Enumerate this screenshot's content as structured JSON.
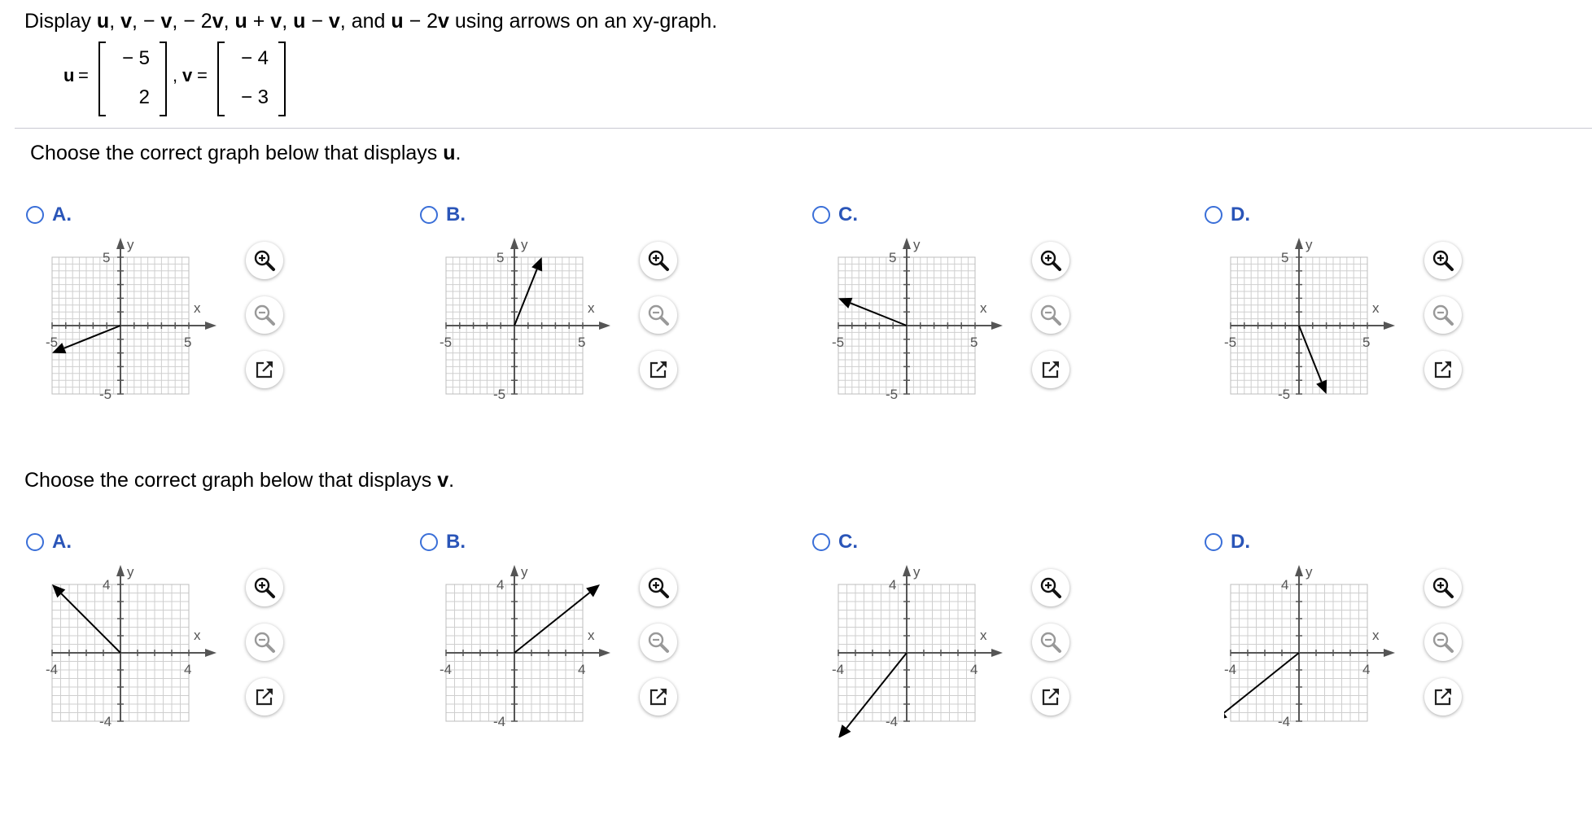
{
  "problem": {
    "prompt_parts": [
      "Display ",
      "u",
      ", ",
      "v",
      ",  − ",
      "v",
      ",  − 2",
      "v",
      ", ",
      "u",
      " + ",
      "v",
      ", ",
      "u",
      " − ",
      "v",
      ", and ",
      "u",
      " − 2",
      "v",
      " using arrows on an xy-graph."
    ],
    "u_label": "u",
    "v_label": "v",
    "equals": "=",
    "comma": ",",
    "u_entries": [
      "− 5",
      "2"
    ],
    "v_entries": [
      "− 4",
      "− 3"
    ]
  },
  "questions": [
    {
      "text_before": "Choose the correct graph below that displays ",
      "text_bold": "u",
      "text_after": ".",
      "range": 5,
      "tick_labels": {
        "x_neg": "-5",
        "x_pos": "5",
        "y_pos": "5",
        "y_neg": "-5"
      },
      "options": [
        {
          "letter": "A.",
          "vector": [
            -5,
            -2
          ]
        },
        {
          "letter": "B.",
          "vector": [
            2,
            5
          ]
        },
        {
          "letter": "C.",
          "vector": [
            -5,
            2
          ]
        },
        {
          "letter": "D.",
          "vector": [
            2,
            -5
          ]
        }
      ]
    },
    {
      "text_before": "Choose the correct graph below that displays ",
      "text_bold": "v",
      "text_after": ".",
      "range": 4,
      "tick_labels": {
        "x_neg": "-4",
        "x_pos": "4",
        "y_pos": "4",
        "y_neg": "-4"
      },
      "options": [
        {
          "letter": "A.",
          "vector": [
            -4,
            4
          ]
        },
        {
          "letter": "B.",
          "vector": [
            5,
            4
          ]
        },
        {
          "letter": "C.",
          "vector": [
            -4,
            -5
          ]
        },
        {
          "letter": "D.",
          "vector": [
            -5,
            -4
          ]
        }
      ]
    }
  ],
  "axis_labels": {
    "x": "x",
    "y": "y"
  },
  "icons": {
    "zoom_in": "zoom-in-icon",
    "zoom_out": "zoom-out-icon",
    "popout": "popout-icon"
  },
  "colors": {
    "choice": "#2a55b8",
    "radio": "#3a6fd8",
    "divider": "#c8c8d2",
    "grid": "#c8c8c8"
  }
}
